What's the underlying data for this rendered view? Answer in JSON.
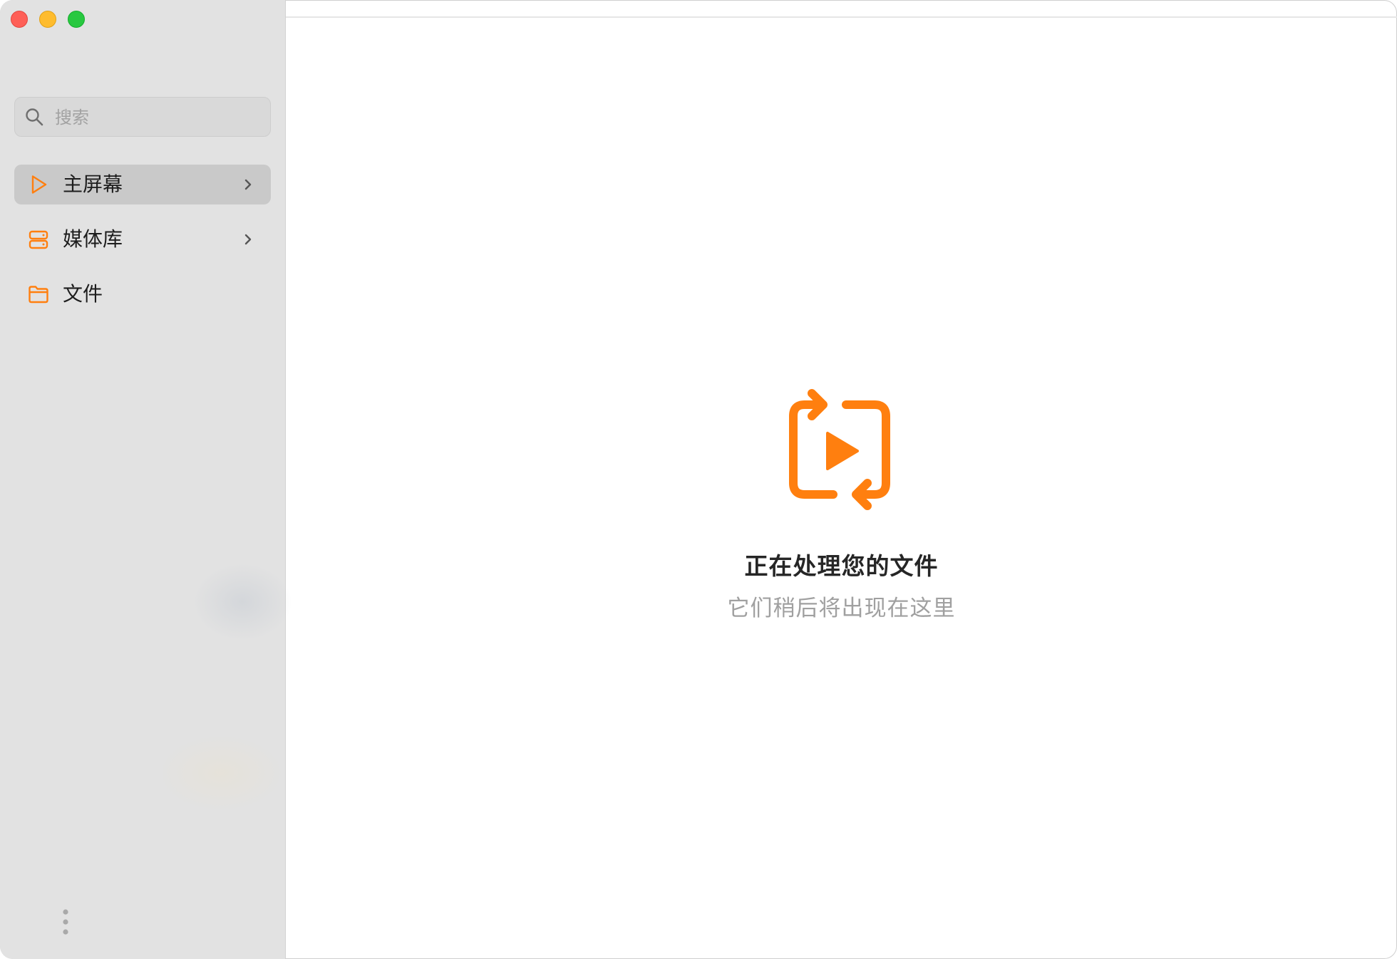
{
  "window": {
    "controls": {
      "close_color": "#fe5f57",
      "minimize_color": "#febc2e",
      "maximize_color": "#28c840"
    }
  },
  "sidebar": {
    "search": {
      "placeholder": "搜索",
      "value": "",
      "icon": "search-icon"
    },
    "items": [
      {
        "label": "主屏幕",
        "icon": "play-outline-icon",
        "selected": true,
        "has_chevron": true
      },
      {
        "label": "媒体库",
        "icon": "server-stack-icon",
        "selected": false,
        "has_chevron": true
      },
      {
        "label": "文件",
        "icon": "folder-icon",
        "selected": false,
        "has_chevron": false
      }
    ],
    "footer_icon": "more-vertical-icon"
  },
  "main": {
    "empty_state": {
      "icon": "play-repeat-icon",
      "title": "正在处理您的文件",
      "subtitle": "它们稍后将出现在这里"
    }
  },
  "colors": {
    "accent": "#ff7f0f",
    "sidebar_bg": "#e2e2e2",
    "selected_bg": "#c9c9c9"
  }
}
